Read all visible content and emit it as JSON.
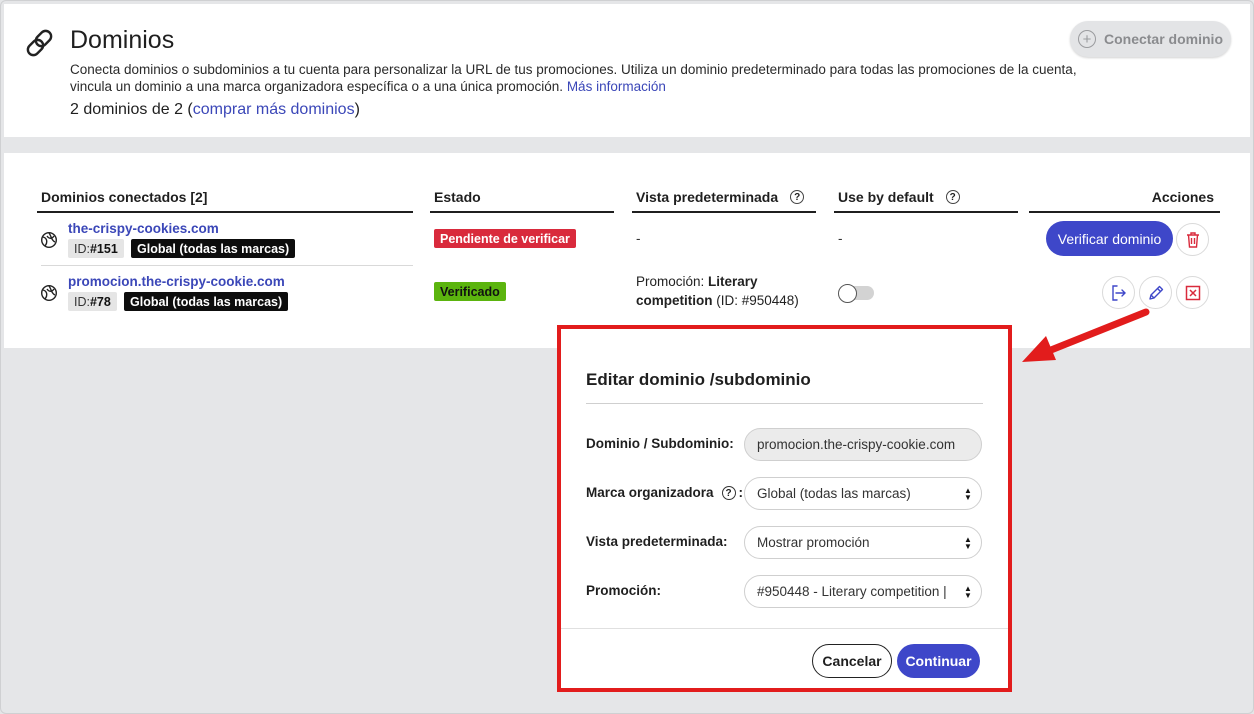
{
  "header": {
    "title": "Dominios",
    "description": "Conecta dominios o subdominios a tu cuenta para personalizar la URL de tus promociones. Utiliza un dominio predeterminado para todas las promociones de la cuenta, vincula un dominio a una marca organizadora específica o a una única promoción.",
    "more_info_link": "Más información",
    "counter_prefix": "2 dominios de 2 (",
    "counter_link": "comprar más dominios",
    "counter_suffix": ")",
    "connect_button": "Conectar dominio",
    "connect_icon": "plus-circle-icon",
    "title_icon": "link-icon"
  },
  "table": {
    "columns": {
      "domains": "Dominios conectados [2]",
      "status": "Estado",
      "default_view": "Vista predeterminada",
      "use_default": "Use by default",
      "actions": "Acciones"
    },
    "rows": [
      {
        "domain": "the-crispy-cookies.com",
        "id_prefix": "ID: ",
        "id": "#151",
        "brand": "Global (todas las marcas)",
        "status": "Pendiente de verificar",
        "status_color": "#d92a3c",
        "default_view": "-",
        "use_default": "-",
        "action_button": "Verificar dominio",
        "action_icons": [
          "trash-icon"
        ]
      },
      {
        "domain": "promocion.the-crispy-cookie.com",
        "id_prefix": "ID: ",
        "id": "#78",
        "brand": "Global (todas las marcas)",
        "status": "Verificado",
        "status_color": "#5bb40e",
        "view_prefix": "Promoción: ",
        "view_name_line1": "Literary",
        "view_name_line2": "competition",
        "view_id": " (ID: #950448)",
        "use_default_toggle": false,
        "action_icons": [
          "sign-in-icon",
          "pencil-icon",
          "close-box-icon"
        ]
      }
    ]
  },
  "modal": {
    "title": "Editar dominio /subdominio",
    "fields": {
      "domain_label": "Dominio / Subdominio:",
      "domain_value": "promocion.the-crispy-cookie.com",
      "brand_label": "Marca organizadora",
      "brand_colon": ":",
      "brand_value": "Global (todas las marcas)",
      "view_label": "Vista predeterminada:",
      "view_value": "Mostrar promoción",
      "promo_label": "Promoción:",
      "promo_value": "#950448 - Literary competition |"
    },
    "cancel": "Cancelar",
    "continue": "Continuar"
  },
  "colors": {
    "accent": "#3e47c9",
    "link": "#3b47b8",
    "highlight_border": "#e21c1c"
  }
}
